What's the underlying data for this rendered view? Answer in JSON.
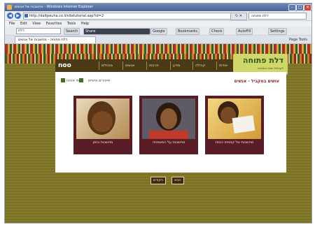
{
  "window": {
    "title": "מחשבות של אנשים - Windows Internet Explorer"
  },
  "address": {
    "url": "http://daltpeuha.co.il/sitetutorial.asp?id=2",
    "search_placeholder": "דלת פתוחה"
  },
  "menu": {
    "items": [
      "File",
      "Edit",
      "View",
      "Favorites",
      "Tools",
      "Help"
    ]
  },
  "toolbar": {
    "search_value": "דלת",
    "buttons": [
      "Search",
      "Share",
      "Google",
      "Bookmarks",
      "Check",
      "AutoFill",
      "Settings"
    ]
  },
  "tabs": {
    "active": "דלת פתוחה - מחשבות של אנשים",
    "tools": [
      "Page",
      "Tools"
    ]
  },
  "site": {
    "logo": "noo",
    "brand_name": "דלת פתוחה",
    "brand_sub": "לקהילת יוצאי אתיופיה",
    "nav": [
      "מנהלים",
      "אנשים",
      "תרבות",
      "מידע",
      "קהילה",
      "אודות"
    ],
    "breadcrumb": "עושים במקביל - אנשים",
    "links": [
      "סיפורים אישיים",
      "מי אנחנו"
    ],
    "cards": [
      {
        "caption": "מחשבות של קמפיס כנסת"
      },
      {
        "caption": "מחשבות על המשפחה"
      },
      {
        "caption": "מחשבות בזמן"
      }
    ],
    "pager": {
      "prev": "הקודם",
      "next": "הבא"
    }
  },
  "colors": {
    "accent": "#5a1d28",
    "brand": "#cfd66a",
    "background": "#7c7226"
  }
}
